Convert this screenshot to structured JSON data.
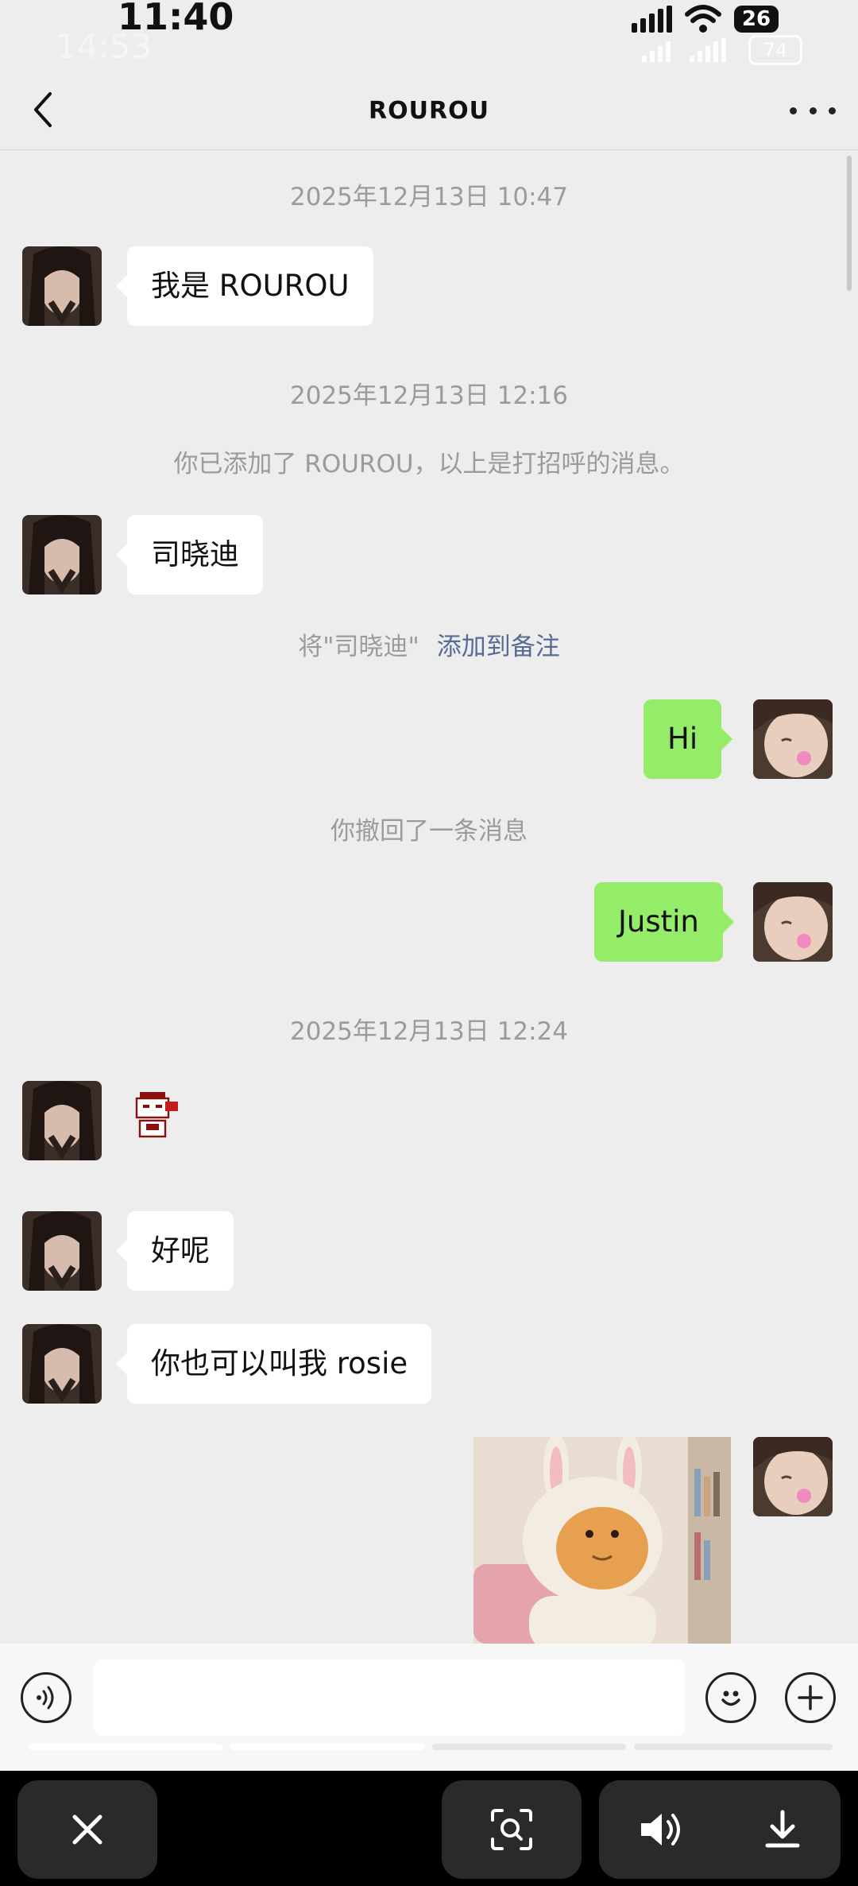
{
  "status_bar": {
    "time": "11:40",
    "battery": "26",
    "ghost_time": "14:53",
    "ghost_battery": "74"
  },
  "header": {
    "title": "ROUROU"
  },
  "messages": {
    "ts1": "2025年12月13日 10:47",
    "m1": "我是 ROUROU",
    "ts2": "2025年12月13日 12:16",
    "sys_added": "你已添加了 ROUROU，以上是打招呼的消息。",
    "m2": "司晓迪",
    "remark_hint": "将\"司晓迪\"",
    "remark_link": "添加到备注",
    "m3": "Hi",
    "sys_recalled": "你撤回了一条消息",
    "m4": "Justin",
    "ts3": "2025年12月13日 12:24",
    "m6": "好呢",
    "m7": "你也可以叫我 rosie"
  },
  "colors": {
    "background": "#ededed",
    "bubble_out": "#95ec69",
    "bubble_in": "#ffffff",
    "link": "#576b95"
  },
  "icons": [
    "back-chevron-icon",
    "more-dots-icon",
    "voice-icon",
    "emoji-icon",
    "plus-icon",
    "close-icon",
    "scan-search-icon",
    "speaker-icon",
    "download-icon"
  ]
}
